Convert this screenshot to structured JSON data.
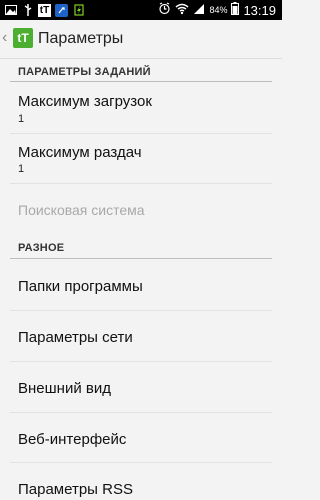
{
  "status_bar": {
    "icons_left": [
      "image-icon",
      "usb-icon",
      "tt-app-icon",
      "shazam-icon",
      "battery-charge-icon"
    ],
    "battery_percent": "84%",
    "time": "13:19"
  },
  "action_bar": {
    "logo_text": "tT",
    "title": "Параметры"
  },
  "sections": {
    "tasks": {
      "header": "ПАРАМЕТРЫ ЗАДАНИЙ"
    },
    "misc": {
      "header": "РАЗНОЕ"
    }
  },
  "items": {
    "max_downloads": {
      "title": "Максимум загрузок",
      "value": "1"
    },
    "max_uploads": {
      "title": "Максимум раздач",
      "value": "1"
    },
    "search_engine": {
      "title": "Поисковая система",
      "enabled": false
    },
    "program_folders": {
      "title": "Папки программы"
    },
    "network_params": {
      "title": "Параметры сети"
    },
    "appearance": {
      "title": "Внешний вид"
    },
    "web_interface": {
      "title": "Веб-интерфейс"
    },
    "rss_params": {
      "title": "Параметры RSS"
    }
  }
}
